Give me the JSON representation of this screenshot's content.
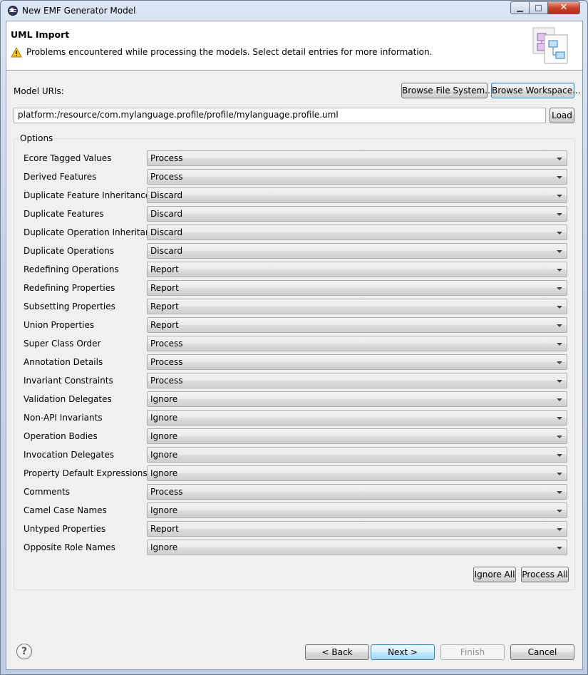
{
  "window": {
    "title": "New EMF Generator Model",
    "controls": {
      "minimize": "▁",
      "maximize": "□",
      "close": "✕"
    }
  },
  "header": {
    "title": "UML Import",
    "message": "Problems encountered while processing the models. Select detail entries for more information.",
    "message_icon": "warning-icon",
    "banner_icon": "uml-model-wizard-icon"
  },
  "model_uris": {
    "label": "Model URIs:",
    "browse_file_system": "Browse File System...",
    "browse_workspace": "Browse Workspace...",
    "value": "platform:/resource/com.mylanguage.profile/profile/mylanguage.profile.uml",
    "load": "Load"
  },
  "options": {
    "title": "Options",
    "rows": [
      {
        "label": "Ecore Tagged Values",
        "value": "Process"
      },
      {
        "label": "Derived Features",
        "value": "Process"
      },
      {
        "label": "Duplicate Feature Inheritance",
        "value": "Discard"
      },
      {
        "label": "Duplicate Features",
        "value": "Discard"
      },
      {
        "label": "Duplicate Operation Inheritance",
        "value": "Discard"
      },
      {
        "label": "Duplicate Operations",
        "value": "Discard"
      },
      {
        "label": "Redefining Operations",
        "value": "Report"
      },
      {
        "label": "Redefining Properties",
        "value": "Report"
      },
      {
        "label": "Subsetting Properties",
        "value": "Report"
      },
      {
        "label": "Union Properties",
        "value": "Report"
      },
      {
        "label": "Super Class Order",
        "value": "Process"
      },
      {
        "label": "Annotation Details",
        "value": "Process"
      },
      {
        "label": "Invariant Constraints",
        "value": "Process"
      },
      {
        "label": "Validation Delegates",
        "value": "Ignore"
      },
      {
        "label": "Non-API Invariants",
        "value": "Ignore"
      },
      {
        "label": "Operation Bodies",
        "value": "Ignore"
      },
      {
        "label": "Invocation Delegates",
        "value": "Ignore"
      },
      {
        "label": "Property Default Expressions",
        "value": "Ignore"
      },
      {
        "label": "Comments",
        "value": "Process"
      },
      {
        "label": "Camel Case Names",
        "value": "Ignore"
      },
      {
        "label": "Untyped Properties",
        "value": "Report"
      },
      {
        "label": "Opposite Role Names",
        "value": "Ignore"
      }
    ],
    "ignore_all": "Ignore All",
    "process_all": "Process All"
  },
  "footer": {
    "help_icon": "help-icon",
    "help_glyph": "?",
    "back": "< Back",
    "next": "Next >",
    "finish": "Finish",
    "cancel": "Cancel"
  }
}
